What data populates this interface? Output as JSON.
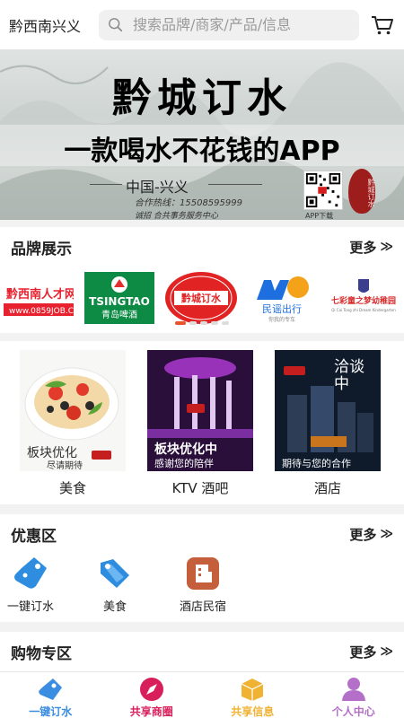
{
  "header": {
    "city": "黔西南兴义",
    "search_placeholder": "搜索品牌/商家/产品/信息"
  },
  "banner": {
    "title": "黔城订水",
    "slogan": "一款喝水不花钱的APP",
    "region": "中国-兴义",
    "hotline": "合作热线：15508595999",
    "slogan2": "诚招 合共事务服务中心",
    "qr_caption": "APP下载",
    "seal_text": "黔城订水"
  },
  "brands_section": {
    "title": "品牌展示",
    "more": "更多",
    "brands": [
      {
        "name": "黔西南人才网",
        "sub": "www.0859JOB.COM"
      },
      {
        "name": "TSINGTAO",
        "sub": "青岛啤酒"
      },
      {
        "name": "黔城订水"
      },
      {
        "name": "民谣出行",
        "sub": "你我的专车"
      },
      {
        "name": "七彩童之梦幼稚园",
        "sub": "Qi Cai Tong zhi Dream Kindergarten"
      }
    ],
    "carousel_pages": 5,
    "carousel_active": 1
  },
  "categories": [
    {
      "label": "美食",
      "caption_line1": "板块优化",
      "caption_line2": "尽请期待"
    },
    {
      "label": "KTV 酒吧",
      "caption_line1": "板块优化中",
      "caption_line2": "感谢您的陪伴"
    },
    {
      "label": "酒店",
      "caption_top": "洽谈中",
      "caption_line2": "期待与您的合作"
    }
  ],
  "promo_section": {
    "title": "优惠区",
    "more": "更多",
    "items": [
      {
        "label": "一键订水",
        "icon": "water-tag-icon"
      },
      {
        "label": "美食",
        "icon": "food-tag-icon"
      },
      {
        "label": "酒店民宿",
        "icon": "hotel-icon"
      }
    ]
  },
  "shopping_section": {
    "title": "购物专区",
    "more": "更多"
  },
  "bottom_nav": [
    {
      "label": "一键订水",
      "color": "#3a8de0",
      "icon": "water-order-icon"
    },
    {
      "label": "共享商圈",
      "color": "#d81e5b",
      "icon": "compass-icon"
    },
    {
      "label": "共享信息",
      "color": "#f0b232",
      "icon": "box-icon"
    },
    {
      "label": "个人中心",
      "color": "#b470c8",
      "icon": "person-icon"
    }
  ]
}
